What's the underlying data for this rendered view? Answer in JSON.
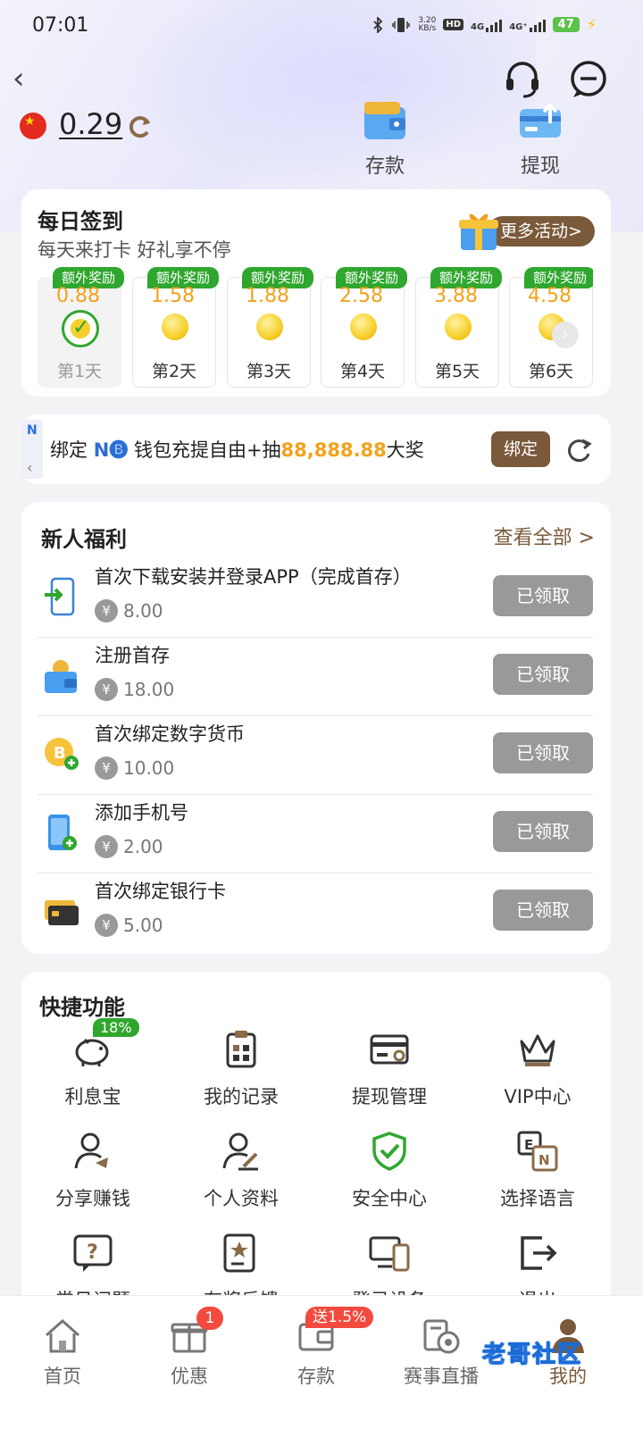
{
  "status_bar": {
    "time": "07:01",
    "net_speed": "3.20",
    "net_unit": "KB/s",
    "hd": "HD",
    "sim1": "4G",
    "sim2": "4G⁺",
    "battery": "47"
  },
  "header": {
    "balance": "0.29",
    "deposit_label": "存款",
    "withdraw_label": "提现"
  },
  "daily_signin": {
    "title": "每日签到",
    "subtitle": "每天来打卡 好礼享不停",
    "more_label": "更多活动>",
    "days": [
      {
        "tag": "额外奖励",
        "amount": "0.88",
        "label": "第1天",
        "done": true
      },
      {
        "tag": "额外奖励",
        "amount": "1.58",
        "label": "第2天",
        "done": false
      },
      {
        "tag": "额外奖励",
        "amount": "1.88",
        "label": "第3天",
        "done": false
      },
      {
        "tag": "额外奖励",
        "amount": "2.58",
        "label": "第4天",
        "done": false
      },
      {
        "tag": "额外奖励",
        "amount": "3.88",
        "label": "第5天",
        "done": false
      },
      {
        "tag": "额外奖励",
        "amount": "4.58",
        "label": "第6天",
        "done": false
      }
    ]
  },
  "bind_banner": {
    "prefix": "绑定 ",
    "brand": "N🅑",
    "mid": " 钱包充提自由+抽",
    "highlight": "88,888.88",
    "suffix": "大奖",
    "button": "绑定"
  },
  "newbie": {
    "title": "新人福利",
    "view_all": "查看全部 >",
    "tasks": [
      {
        "name": "首次下载安装并登录APP（完成首存）",
        "reward": "8.00",
        "status": "已领取",
        "icon": "phone-download-icon"
      },
      {
        "name": "注册首存",
        "reward": "18.00",
        "status": "已领取",
        "icon": "wallet-icon"
      },
      {
        "name": "首次绑定数字货币",
        "reward": "10.00",
        "status": "已领取",
        "icon": "bitcoin-icon"
      },
      {
        "name": "添加手机号",
        "reward": "2.00",
        "status": "已领取",
        "icon": "mobile-add-icon"
      },
      {
        "name": "首次绑定银行卡",
        "reward": "5.00",
        "status": "已领取",
        "icon": "bank-card-icon"
      }
    ],
    "currency": "¥"
  },
  "quick": {
    "title": "快捷功能",
    "badge": "18%",
    "items": [
      {
        "label": "利息宝",
        "icon": "piggy-bank-icon"
      },
      {
        "label": "我的记录",
        "icon": "clipboard-icon"
      },
      {
        "label": "提现管理",
        "icon": "card-gear-icon"
      },
      {
        "label": "VIP中心",
        "icon": "crown-icon"
      },
      {
        "label": "分享赚钱",
        "icon": "user-share-icon"
      },
      {
        "label": "个人资料",
        "icon": "user-edit-icon"
      },
      {
        "label": "安全中心",
        "icon": "shield-check-icon"
      },
      {
        "label": "选择语言",
        "icon": "language-icon"
      },
      {
        "label": "常见问题",
        "icon": "question-icon"
      },
      {
        "label": "有奖反馈",
        "icon": "feedback-icon"
      },
      {
        "label": "登录设备",
        "icon": "devices-icon"
      },
      {
        "label": "退出",
        "icon": "logout-icon"
      }
    ]
  },
  "tabbar": {
    "tabs": [
      {
        "label": "首页",
        "icon": "home-icon"
      },
      {
        "label": "优惠",
        "icon": "gift-icon",
        "badge": "1"
      },
      {
        "label": "存款",
        "icon": "wallet-icon",
        "badge": "送1.5%"
      },
      {
        "label": "赛事直播",
        "icon": "live-icon"
      },
      {
        "label": "我的",
        "icon": "user-icon"
      }
    ]
  },
  "watermark": "老哥社区",
  "colors": {
    "brand_brown": "#7a5a3a",
    "reward_orange": "#f3a21b",
    "success_green": "#2fa72f",
    "badge_red": "#f24a3e"
  }
}
